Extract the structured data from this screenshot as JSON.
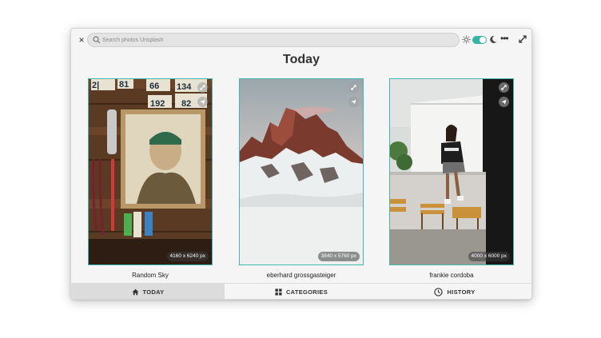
{
  "window": {
    "close_label": "×",
    "search": {
      "placeholder": "Search photos Unsplash",
      "value": ""
    },
    "dark_mode_toggle": {
      "on": true
    },
    "menu_label": "•••",
    "accent_color": "#33b5a5"
  },
  "page": {
    "title": "Today"
  },
  "photos": [
    {
      "author": "Random Sky",
      "resolution": "4160 x 6240  px"
    },
    {
      "author": "eberhard grossgasteiger",
      "resolution": "3840 x 5760  px"
    },
    {
      "author": "frankie cordoba",
      "resolution": "4000 x 6000  px"
    }
  ],
  "bottom_tabs": [
    {
      "label": "TODAY",
      "icon": "home-icon",
      "active": true
    },
    {
      "label": "CATEGORIES",
      "icon": "grid-icon",
      "active": false
    },
    {
      "label": "HISTORY",
      "icon": "clock-icon",
      "active": false
    }
  ]
}
